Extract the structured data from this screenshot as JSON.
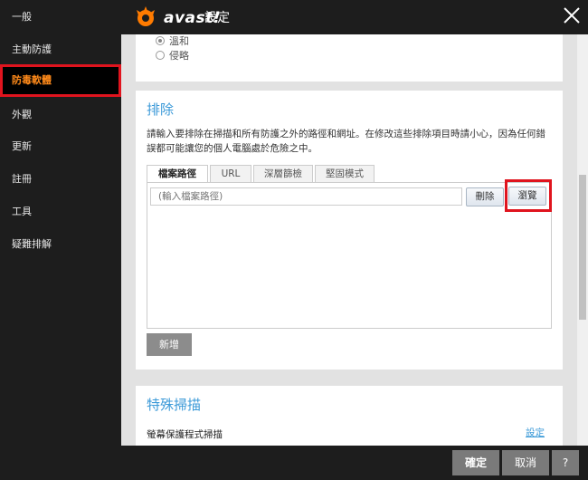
{
  "window": {
    "brand": "avast!",
    "title": "設定"
  },
  "sidebar": {
    "items": [
      {
        "label": "一般"
      },
      {
        "label": "主動防護"
      },
      {
        "label": "防毒軟體"
      },
      {
        "label": "外觀"
      },
      {
        "label": "更新"
      },
      {
        "label": "註冊"
      },
      {
        "label": "工具"
      },
      {
        "label": "疑難排解"
      }
    ],
    "active_index": 2
  },
  "section_top": {
    "options": [
      {
        "label": "溫和",
        "checked": true
      },
      {
        "label": "侵略",
        "checked": false
      }
    ]
  },
  "exclusions": {
    "title": "排除",
    "description": "請輸入要排除在掃描和所有防護之外的路徑和網址。在修改這些排除項目時請小心，因為任何錯誤都可能讓您的個人電腦處於危險之中。",
    "tabs": [
      {
        "label": "檔案路徑"
      },
      {
        "label": "URL"
      },
      {
        "label": "深層篩檢"
      },
      {
        "label": "堅固模式"
      }
    ],
    "active_tab": 0,
    "path_placeholder": "(輸入檔案路徑)",
    "delete_label": "刪除",
    "browse_label": "瀏覽",
    "add_label": "新增"
  },
  "special_scans": {
    "title": "特殊掃描",
    "screensaver_label": "螢幕保護程式掃描",
    "settings_link": "設定"
  },
  "footer": {
    "ok_label": "確定",
    "cancel_label": "取消",
    "help_label": "?"
  },
  "colors": {
    "accent_orange": "#ff8a1a",
    "highlight_red": "#e0141e",
    "section_blue": "#3c9ad8"
  }
}
